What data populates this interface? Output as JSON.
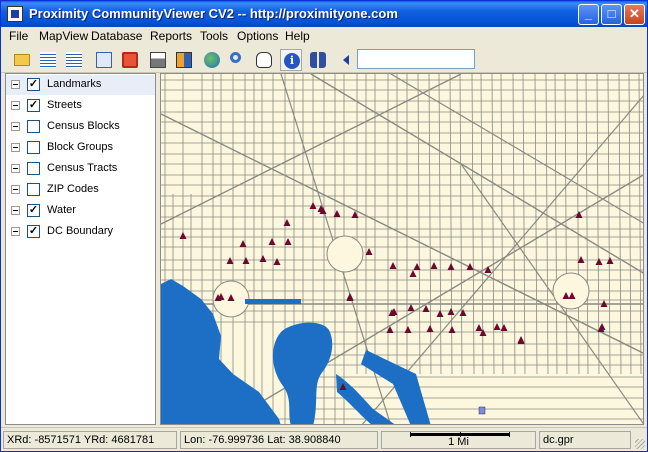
{
  "window": {
    "title": "Proximity CommunityViewer CV2 -- http://proximityone.com"
  },
  "titlebar_buttons": [
    "minimize",
    "maximize",
    "close"
  ],
  "menu": [
    "File",
    "MapView",
    "Database",
    "Reports",
    "Tools",
    "Options",
    "Help"
  ],
  "toolbar": {
    "tools": [
      "open-folder-icon",
      "add-layer-icon",
      "remove-layer-icon",
      "edit-icon",
      "record-icon",
      "print-icon",
      "report-icon",
      "globe-icon",
      "zoom-icon",
      "pan-hand-icon",
      "info-icon",
      "find-icon",
      "back-arrow-icon"
    ],
    "active_tool": "info-icon",
    "search_value": ""
  },
  "layers": [
    {
      "label": "Landmarks",
      "checked": true,
      "selected": true
    },
    {
      "label": "Streets",
      "checked": true,
      "selected": false
    },
    {
      "label": "Census Blocks",
      "checked": false,
      "selected": false
    },
    {
      "label": "Block Groups",
      "checked": false,
      "selected": false
    },
    {
      "label": "Census Tracts",
      "checked": false,
      "selected": false
    },
    {
      "label": "ZIP Codes",
      "checked": false,
      "selected": false
    },
    {
      "label": "Water",
      "checked": true,
      "selected": false
    },
    {
      "label": "DC Boundary",
      "checked": true,
      "selected": false
    }
  ],
  "map": {
    "colors": {
      "land": "#FCF7DE",
      "water": "#1D6FC6",
      "street": "#8A8A82",
      "landmark": "#6B0A2E"
    },
    "landmark_count": 54
  },
  "status": {
    "xrd_label": "XRd:",
    "xrd_value": "-8571571",
    "yrd_label": "YRd:",
    "yrd_value": "4681781",
    "lon_label": "Lon:",
    "lon_value": "-76.999736",
    "lat_label": "Lat:",
    "lat_value": "38.908840",
    "scale_label": "1 Mi",
    "project_file": "dc.gpr"
  }
}
